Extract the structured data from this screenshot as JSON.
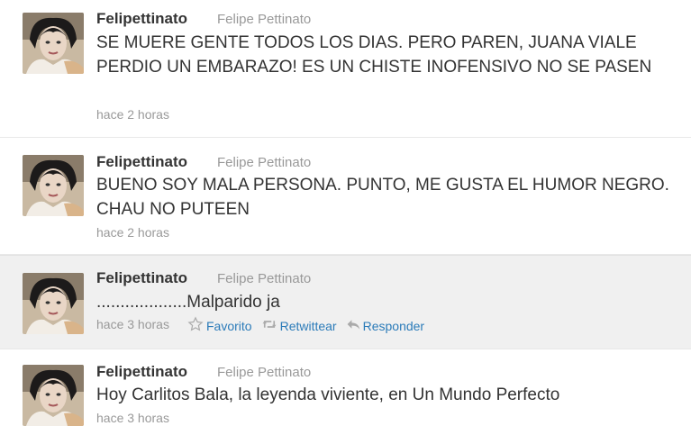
{
  "tweets": [
    {
      "username": "Felipettinato",
      "fullname": "Felipe Pettinato",
      "text": "SE MUERE GENTE TODOS LOS DIAS. PERO PAREN, JUANA VIALE PERDIO UN EMBARAZO! ES UN CHISTE INOFENSIVO NO SE PASEN",
      "time": "hace 2 horas"
    },
    {
      "username": "Felipettinato",
      "fullname": "Felipe Pettinato",
      "text": "BUENO SOY MALA PERSONA. PUNTO, ME GUSTA EL HUMOR NEGRO. CHAU NO PUTEEN",
      "time": "hace 2 horas"
    },
    {
      "username": "Felipettinato",
      "fullname": "Felipe Pettinato",
      "text": "...................Malparido ja",
      "time": "hace 3 horas",
      "actions": {
        "favorite": "Favorito",
        "retweet": "Retwittear",
        "reply": "Responder"
      }
    },
    {
      "username": "Felipettinato",
      "fullname": "Felipe Pettinato",
      "text": "Hoy Carlitos Bala, la leyenda viviente, en Un Mundo Perfecto",
      "time": "hace 3 horas"
    }
  ],
  "icons": {
    "favorite": "star-icon",
    "retweet": "retweet-icon",
    "reply": "reply-icon"
  },
  "colors": {
    "link": "#2b7bb9",
    "meta": "#999999",
    "hover_bg": "#f0f0f0"
  }
}
